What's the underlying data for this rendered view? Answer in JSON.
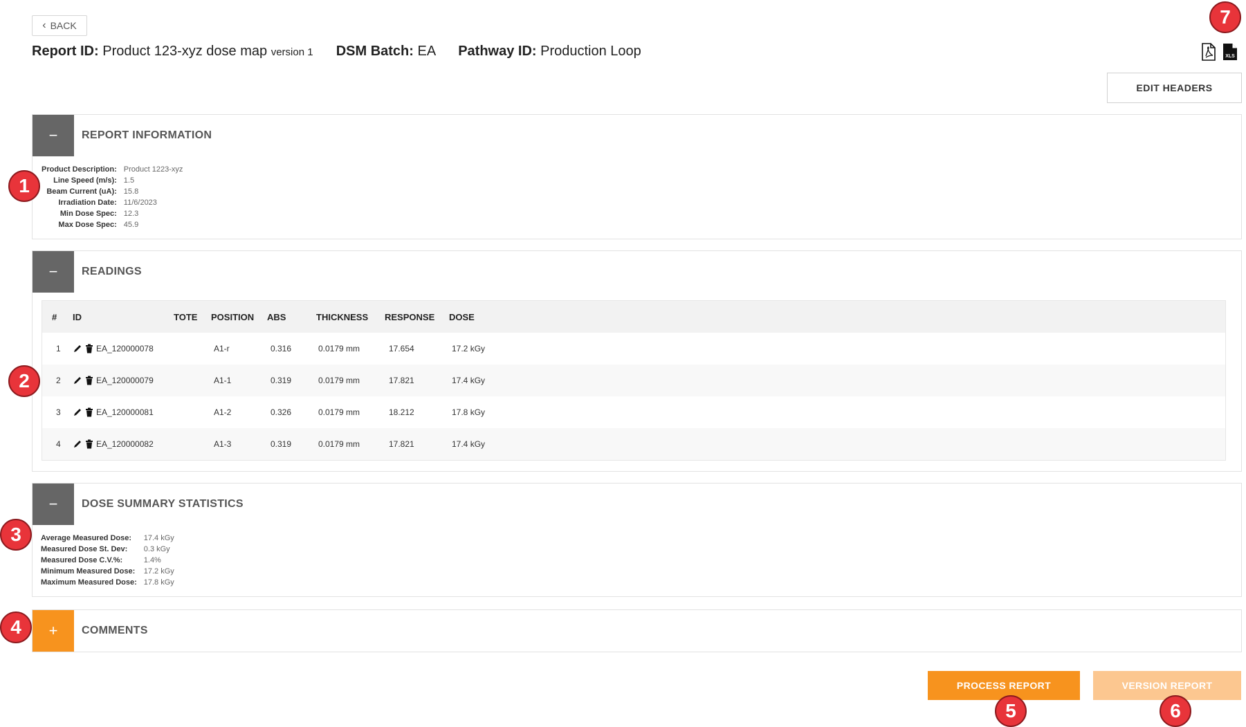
{
  "back_label": "BACK",
  "report": {
    "id_label": "Report ID:",
    "id_value": "Product 123-xyz dose map",
    "version": "version 1",
    "batch_label": "DSM Batch:",
    "batch_value": "EA",
    "pathway_label": "Pathway ID:",
    "pathway_value": "Production Loop"
  },
  "export_icons": [
    "pdf-export-icon",
    "xls-export-icon"
  ],
  "export_xls_text": "XLS",
  "edit_headers_label": "EDIT HEADERS",
  "sections": {
    "report_information": {
      "title": "REPORT INFORMATION",
      "toggle": "−",
      "fields": [
        {
          "label": "Product Description:",
          "value": "Product 1223-xyz"
        },
        {
          "label": "Line Speed (m/s):",
          "value": "1.5"
        },
        {
          "label": "Beam Current (uA):",
          "value": "15.8"
        },
        {
          "label": "Irradiation Date:",
          "value": "11/6/2023"
        },
        {
          "label": "Min Dose Spec:",
          "value": "12.3"
        },
        {
          "label": "Max Dose Spec:",
          "value": "45.9"
        }
      ]
    },
    "readings": {
      "title": "READINGS",
      "toggle": "−",
      "columns": [
        "#",
        "ID",
        "TOTE",
        "POSITION",
        "ABS",
        "THICKNESS",
        "RESPONSE",
        "DOSE"
      ],
      "rows": [
        {
          "num": "1",
          "id": "EA_120000078",
          "tote": "",
          "position": "A1-r",
          "abs": "0.316",
          "thickness": "0.0179 mm",
          "response": "17.654",
          "dose": "17.2 kGy"
        },
        {
          "num": "2",
          "id": "EA_120000079",
          "tote": "",
          "position": "A1-1",
          "abs": "0.319",
          "thickness": "0.0179 mm",
          "response": "17.821",
          "dose": "17.4 kGy"
        },
        {
          "num": "3",
          "id": "EA_120000081",
          "tote": "",
          "position": "A1-2",
          "abs": "0.326",
          "thickness": "0.0179 mm",
          "response": "18.212",
          "dose": "17.8 kGy"
        },
        {
          "num": "4",
          "id": "EA_120000082",
          "tote": "",
          "position": "A1-3",
          "abs": "0.319",
          "thickness": "0.0179 mm",
          "response": "17.821",
          "dose": "17.4 kGy"
        }
      ]
    },
    "dose_summary": {
      "title": "DOSE SUMMARY STATISTICS",
      "toggle": "−",
      "fields": [
        {
          "label": "Average Measured Dose:",
          "value": "17.4 kGy"
        },
        {
          "label": "Measured Dose St. Dev:",
          "value": "0.3 kGy"
        },
        {
          "label": "Measured Dose C.V.%:",
          "value": "1.4%"
        },
        {
          "label": "Minimum Measured Dose:",
          "value": "17.2 kGy"
        },
        {
          "label": "Maximum Measured Dose:",
          "value": "17.8 kGy"
        }
      ]
    },
    "comments": {
      "title": "COMMENTS",
      "toggle": "+"
    }
  },
  "process_report_label": "PROCESS REPORT",
  "version_report_label": "VERSION REPORT",
  "colors": {
    "accent_orange": "#f7931e",
    "disabled_orange": "#fcc790",
    "toggle_gray": "#666666",
    "callout_red": "#e8343a"
  },
  "callouts": [
    "1",
    "2",
    "3",
    "4",
    "5",
    "6",
    "7"
  ]
}
